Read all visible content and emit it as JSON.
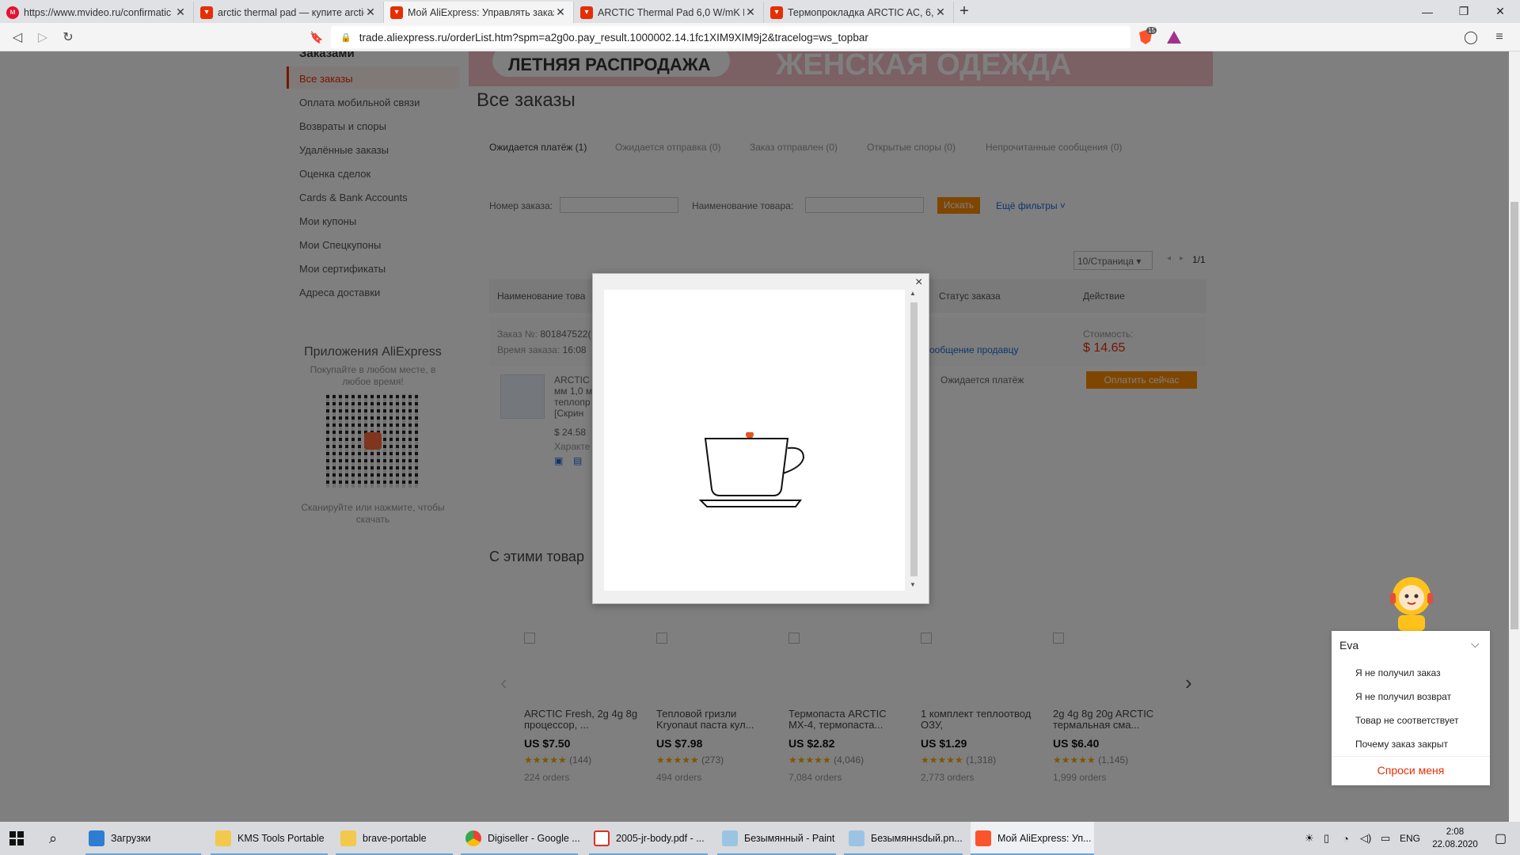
{
  "browser": {
    "tabs": [
      {
        "title": "https://www.mvideo.ru/confirmatic",
        "icon": "mvideo-icon"
      },
      {
        "title": "arctic thermal pad — купите arctic",
        "icon": "aliexpress-icon"
      },
      {
        "title": "Мой AliExpress: Управлять заказа",
        "icon": "aliexpress-icon"
      },
      {
        "title": "ARCTIC Thermal Pad 6,0 W/mK Пр",
        "icon": "aliexpress-icon"
      },
      {
        "title": "Термопрокладка ARCTIC AC, 6,0 I",
        "icon": "aliexpress-icon"
      }
    ],
    "active_tab": 2,
    "new_tab": "+",
    "url": "trade.aliexpress.ru/orderList.htm?spm=a2g0o.pay_result.1000002.14.1fc1XIM9XIM9j2&tracelog=ws_topbar",
    "shield_badge": "15"
  },
  "sidebar": {
    "heading": "Заказами",
    "items": [
      "Все заказы",
      "Оплата мобильной связи",
      "Возвраты и споры",
      "Удалённые заказы",
      "Оценка сделок",
      "Cards & Bank Accounts",
      "Мои купоны",
      "Мои Спецкупоны",
      "Мои сертификаты",
      "Адреса доставки"
    ],
    "active_index": 0
  },
  "apps": {
    "title": "Приложения AliExpress",
    "subtitle": "Покупайте в любом месте, в любое время!",
    "caption": "Сканируйте или нажмите, чтобы скачать"
  },
  "banner": {
    "left": "ЛЕТНЯЯ РАСПРОДАЖА",
    "right": "ЖЕНСКАЯ ОДЕЖДА"
  },
  "main": {
    "title": "Все заказы",
    "status_tabs": [
      "Ожидается платёж (1)",
      "Ожидается отправка (0)",
      "Заказ отправлен (0)",
      "Открытые споры (0)",
      "Непрочитанные сообщения (0)"
    ],
    "filters": {
      "order_no_label": "Номер заказа:",
      "product_label": "Наименование товара:",
      "search_btn": "Искать",
      "more": "Ещё фильтры"
    },
    "pager": {
      "per_page": "10/Страница",
      "page": "1/1"
    },
    "table_headers": [
      "Наименование това",
      "Статус заказа",
      "Действие"
    ],
    "order": {
      "no_label": "Заказ №:",
      "no_value": "801847522(",
      "time_label": "Время заказа:",
      "time_value": "16:08",
      "message_seller": "ообщение продавцу",
      "cost_label": "Стоимость:",
      "cost_value": "$ 14.65",
      "product_lines": [
        "ARCTIC",
        "мм 1,0 м",
        "теплопр",
        "[Скрин"
      ],
      "product_price": "$ 24.58 ",
      "characteristics": "Характе",
      "status": "Ожидается платёж",
      "pay_btn": "Оплатить сейчас"
    },
    "recommend_title": "С этими товар",
    "products": [
      {
        "name": "ARCTIC Fresh, 2g 4g 8g процессор, ...",
        "price": "US $7.50",
        "reviews": "(144)",
        "orders": "224 orders"
      },
      {
        "name": "Тепловой гризли Kryonaut паста кул...",
        "price": "US $7.98",
        "reviews": "(273)",
        "orders": "494 orders"
      },
      {
        "name": "Термопаста ARCTIC MX-4, термопаста...",
        "price": "US $2.82",
        "reviews": "(4,046)",
        "orders": "7,084 orders"
      },
      {
        "name": "1 комплект теплоотвод ОЗУ,",
        "price": "US $1.29",
        "reviews": "(1,318)",
        "orders": "2,773 orders"
      },
      {
        "name": "2g 4g 8g 20g ARCTIC термальная сма...",
        "price": "US $6.40",
        "reviews": "(1,145)",
        "orders": "1,999 orders"
      }
    ]
  },
  "modal": {
    "close": "×"
  },
  "chat": {
    "name": "Eva",
    "questions": [
      "Я не получил заказ",
      "Я не получил возврат",
      "Товар не соответствует",
      "Почему заказ закрыт"
    ],
    "ask": "Спроси меня"
  },
  "taskbar": {
    "items": [
      "Загрузки",
      "KMS Tools Portable",
      "brave-portable",
      "Digiseller - Google ...",
      "2005-jr-body.pdf - ...",
      "Безымянный - Paint",
      "Безымяннsdый.pn...",
      "Мой AliExpress: Уп..."
    ],
    "lang": "ENG",
    "time": "2:08",
    "date": "22.08.2020"
  }
}
